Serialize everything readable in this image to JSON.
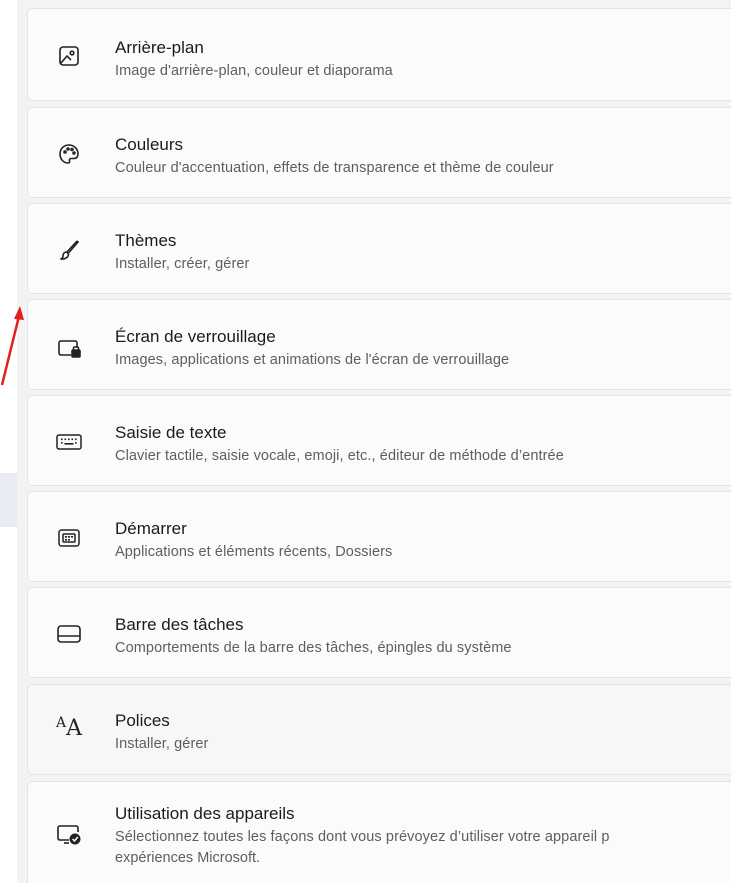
{
  "settings_items": [
    {
      "title": "Arrière-plan",
      "description": "Image d'arrière-plan, couleur et diaporama",
      "icon": "picture-icon"
    },
    {
      "title": "Couleurs",
      "description": "Couleur d'accentuation, effets de transparence et thème de couleur",
      "icon": "palette-icon"
    },
    {
      "title": "Thèmes",
      "description": "Installer, créer, gérer",
      "icon": "brush-icon"
    },
    {
      "title": "Écran de verrouillage",
      "description": "Images, applications et animations de l'écran de verrouillage",
      "icon": "lock-screen-icon"
    },
    {
      "title": "Saisie de texte",
      "description": "Clavier tactile, saisie vocale, emoji, etc., éditeur de méthode d’entrée",
      "icon": "keyboard-icon"
    },
    {
      "title": "Démarrer",
      "description": "Applications et éléments récents, Dossiers",
      "icon": "start-menu-icon"
    },
    {
      "title": "Barre des tâches",
      "description": "Comportements de la barre des tâches, épingles du système",
      "icon": "taskbar-icon"
    },
    {
      "title": "Polices",
      "description": "Installer, gérer",
      "icon": "fonts-icon"
    },
    {
      "title": "Utilisation des appareils",
      "description": "Sélectionnez toutes les façons dont vous prévoyez d’utiliser votre appareil p",
      "description_line2": "expériences Microsoft.",
      "icon": "device-usage-icon"
    }
  ],
  "colors": {
    "annotation_arrow": "#e0201c"
  }
}
